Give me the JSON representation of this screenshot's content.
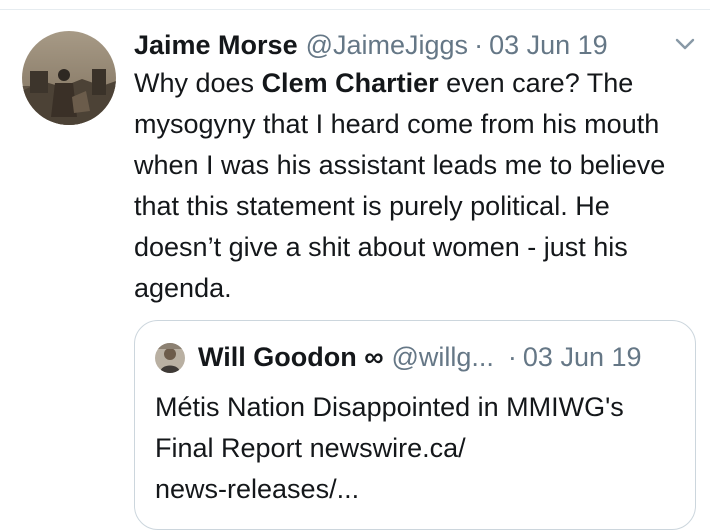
{
  "tweet": {
    "author_name": "Jaime Morse",
    "handle": "@JaimeJiggs",
    "separator": "·",
    "date": "03 Jun 19",
    "text_before": "Why does ",
    "mention": "Clem Chartier",
    "text_after": " even care? The mysogyny that I heard come from his mouth when I was his assistant leads me to believe that this statement is purely political. He doesn’t give a shit about women - just his agenda."
  },
  "quote": {
    "author_name": "Will Goodon ∞",
    "handle": "@willg...",
    "separator": "·",
    "date": "03 Jun 19",
    "text_line1": "Métis Nation Disappointed in MMIWG's",
    "text_line2": "Final Report newswire.ca/",
    "text_line3": "news-releases/..."
  },
  "icons": {
    "menu": "chevron-down-icon",
    "avatar": "user-avatar",
    "quote_avatar": "quoted-user-avatar"
  },
  "colors": {
    "text_primary": "#14171a",
    "text_secondary": "#657786",
    "border": "#ccd6dd"
  }
}
